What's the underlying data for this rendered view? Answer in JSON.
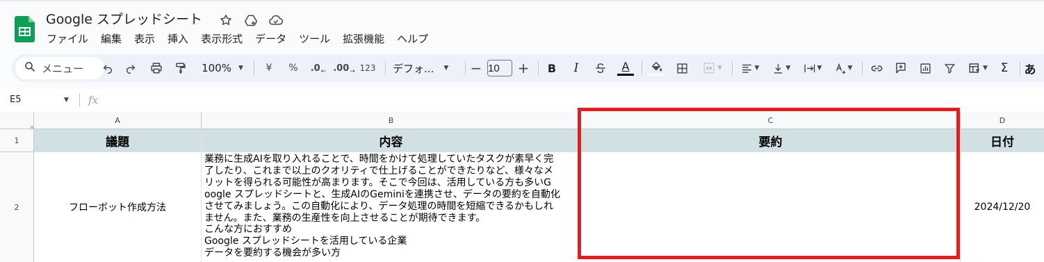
{
  "app": {
    "title": "Google スプレッドシート",
    "brand_color": "#0f9d58"
  },
  "menu": [
    "ファイル",
    "編集",
    "表示",
    "挿入",
    "表示形式",
    "データ",
    "ツール",
    "拡張機能",
    "ヘルプ"
  ],
  "toolbar": {
    "search_label": "メニュー",
    "zoom": "100%",
    "currency": "¥",
    "percent": "%",
    "decrease_decimal": ".0",
    "increase_decimal": ".00",
    "number_format": "123",
    "font": "デフォ...",
    "font_size": "10",
    "bold": "B",
    "italic": "I",
    "text_color_letter": "A",
    "sum": "Σ",
    "input_tool": "あ"
  },
  "formula_bar": {
    "cell_ref": "E5",
    "fx": "fx"
  },
  "grid": {
    "columns": [
      "A",
      "B",
      "C",
      "D"
    ],
    "rows": [
      "1",
      "2"
    ],
    "header_row": [
      "議題",
      "内容",
      "要約",
      "日付"
    ],
    "row2": {
      "topic": "フローボット作成方法",
      "content_lines": [
        "業務に生成AIを取り入れることで、時間をかけて処理していたタスクが素早く完",
        "了したり、これまで以上のクオリティで仕上げることができたりなど、様々なメ",
        "リットを得られる可能性が高まります。そこで今回は、活用している方も多いG",
        "oogle スプレッドシートと、生成AIのGeminiを連携させ、データの要約を自動化",
        "させてみましょう。この自動化により、データ処理の時間を短縮できるかもしれ",
        "ません。また、業務の生産性を向上させることが期待できます。",
        "こんな方におすすめ",
        "Google スプレッドシートを活用している企業",
        "データを要約する機会が多い方"
      ],
      "summary": "",
      "date": "2024/12/20"
    },
    "header_fill": "#d0e0e3",
    "highlight_color": "#e02020"
  }
}
